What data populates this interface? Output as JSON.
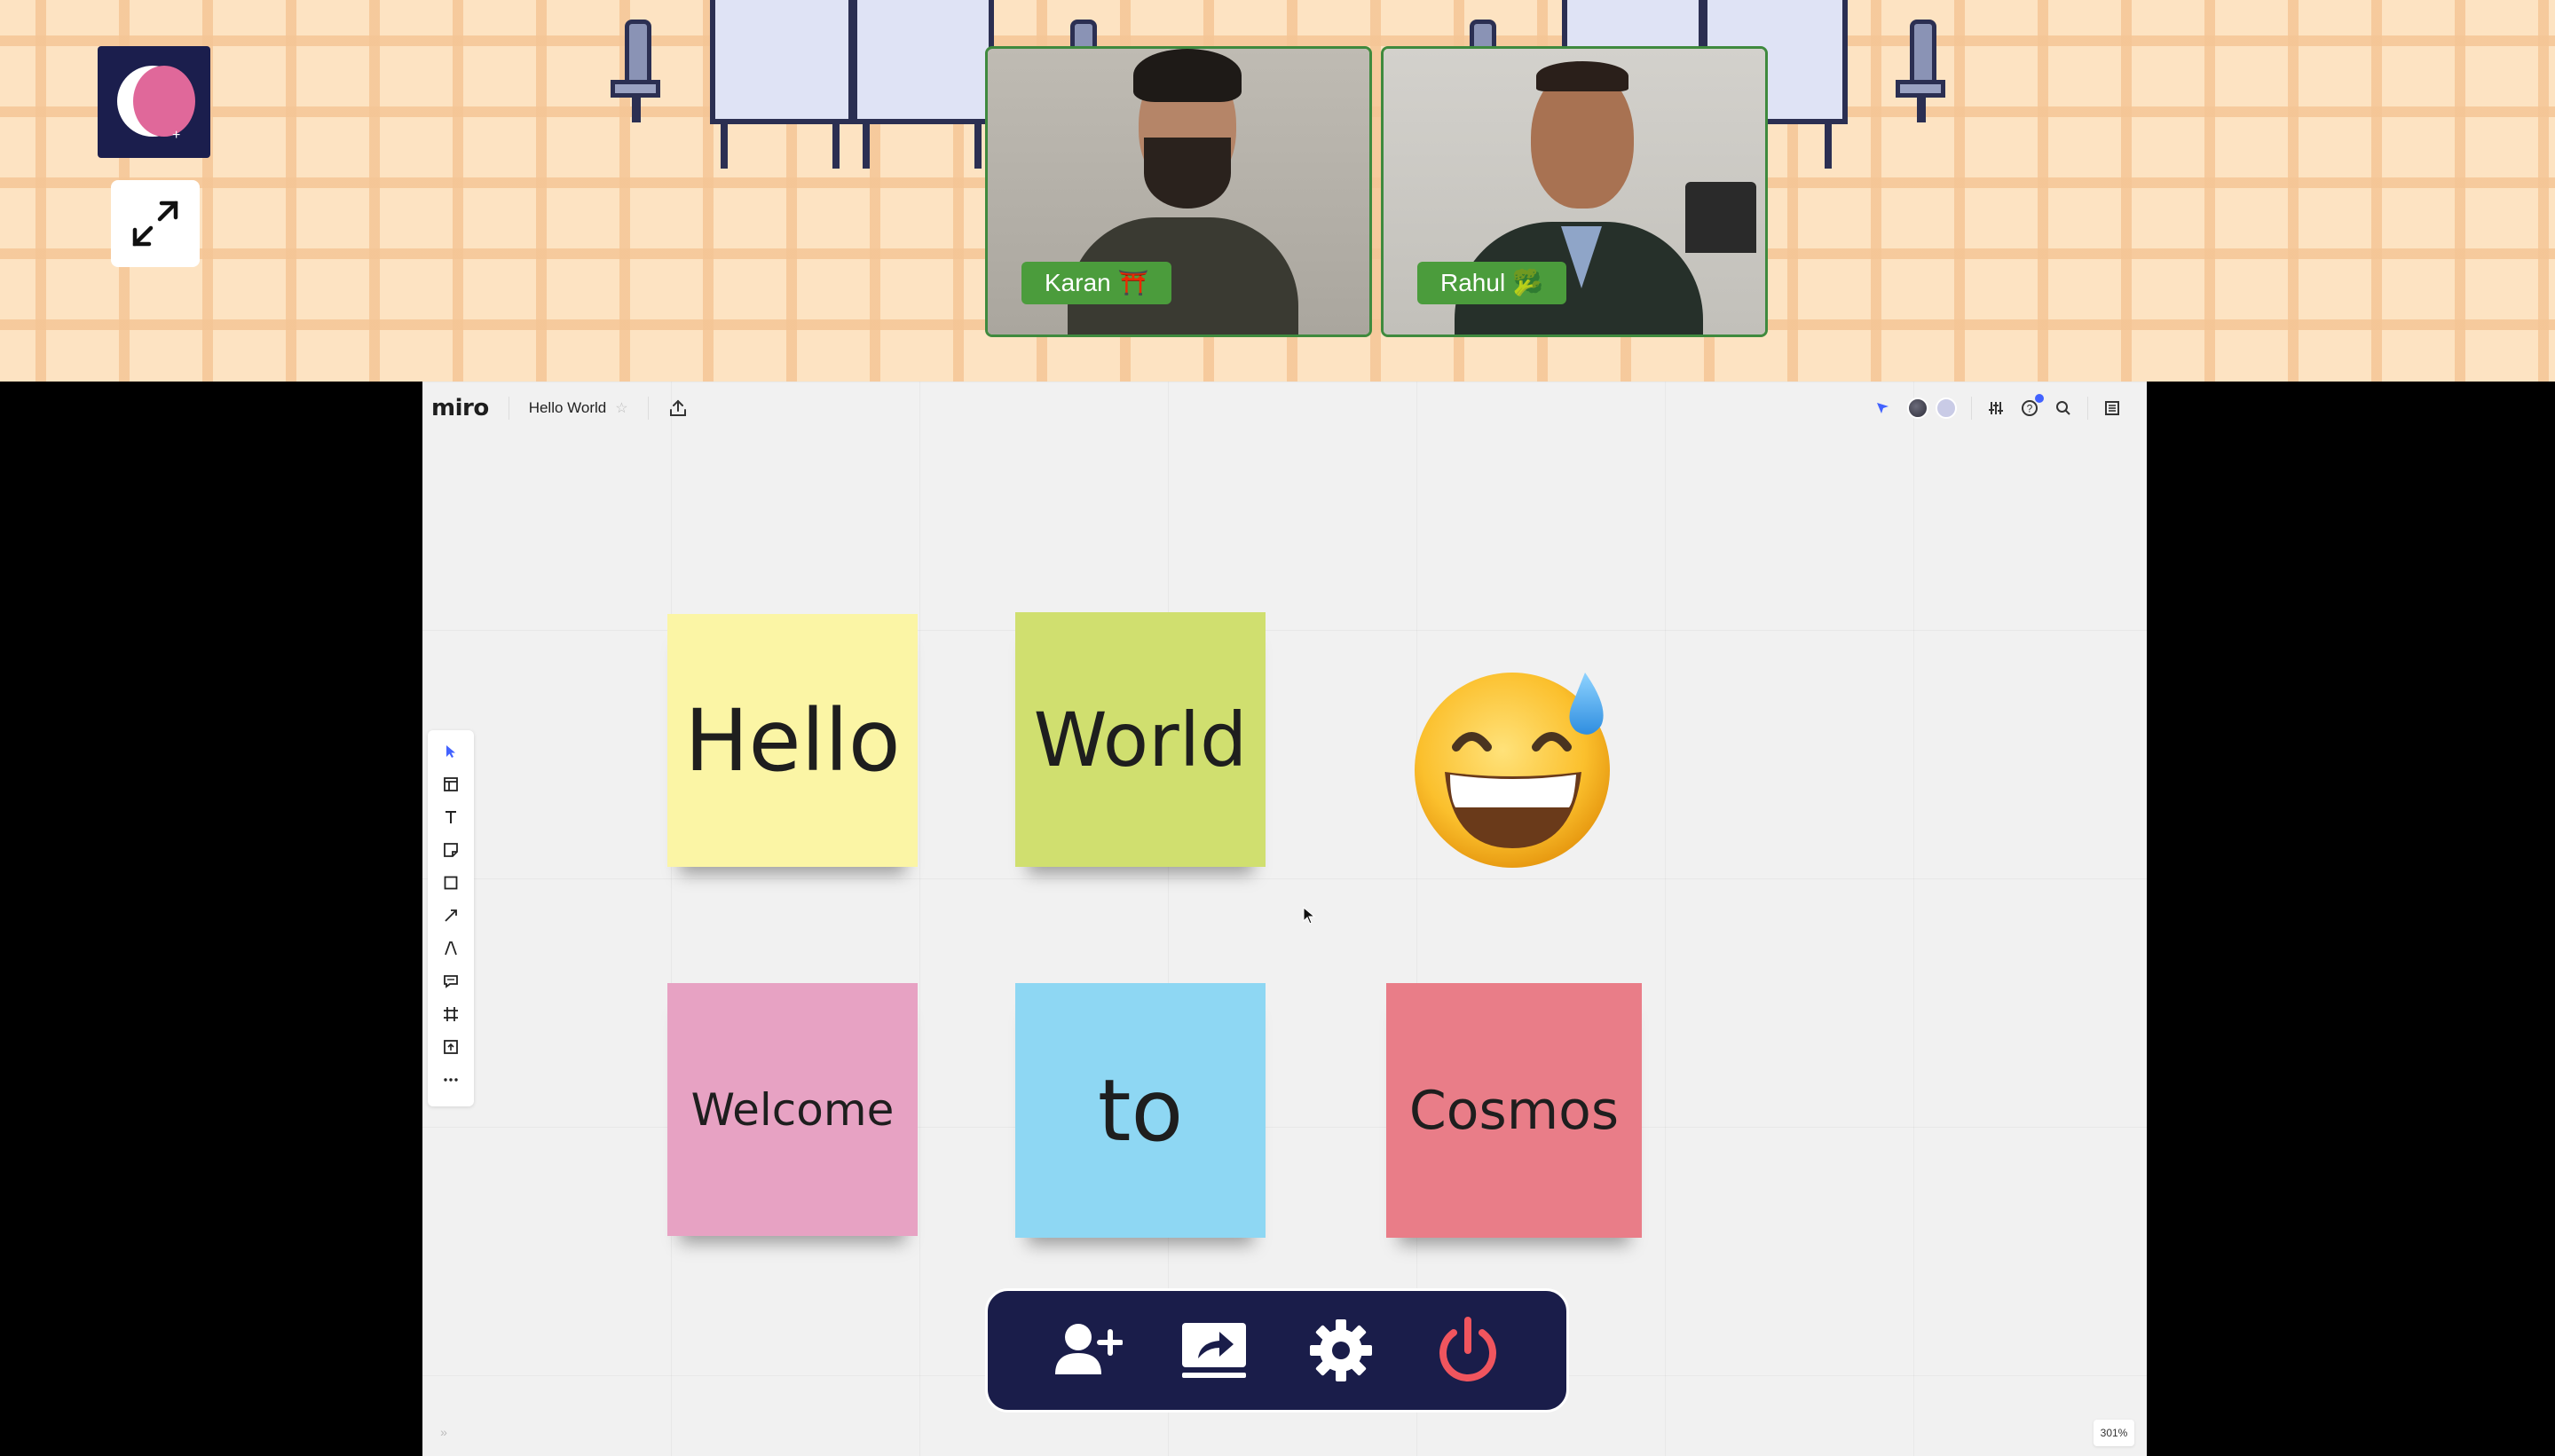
{
  "office": {
    "participants": [
      {
        "name": "Karan ⛩️",
        "video_bg": "#b7b4ad",
        "shirt": "#3a3a32",
        "skin": "#b98a6a"
      },
      {
        "name": "Rahul 🥦",
        "video_bg": "#c9c7c2",
        "shirt": "#26302a",
        "skin": "#a87252"
      }
    ]
  },
  "miro": {
    "logo": "miro",
    "board_name": "Hello World",
    "star": "☆",
    "toolbar": [
      {
        "name": "select-tool",
        "icon": "cursor-arrow-icon"
      },
      {
        "name": "templates-tool",
        "icon": "template-icon"
      },
      {
        "name": "text-tool",
        "icon": "text-icon"
      },
      {
        "name": "sticky-note-tool",
        "icon": "sticky-note-icon"
      },
      {
        "name": "shape-tool",
        "icon": "square-icon"
      },
      {
        "name": "connection-line-tool",
        "icon": "arrow-line-icon"
      },
      {
        "name": "pen-tool",
        "icon": "pen-icon"
      },
      {
        "name": "comment-tool",
        "icon": "comment-icon"
      },
      {
        "name": "frame-tool",
        "icon": "frame-icon"
      },
      {
        "name": "upload-tool",
        "icon": "upload-icon"
      },
      {
        "name": "more-tools",
        "icon": "more-icon"
      }
    ],
    "stickies": [
      {
        "text": "Hello",
        "color": "#fbf5a5"
      },
      {
        "text": "World",
        "color": "#d0df6f"
      },
      {
        "text": "Welcome",
        "color": "#e7a2c3"
      },
      {
        "text": "to",
        "color": "#8ed7f3"
      },
      {
        "text": "Cosmos",
        "color": "#e97d88"
      }
    ],
    "emoji": "grinning-face-with-sweat",
    "zoom": "301%",
    "collapse": "»"
  },
  "controls": [
    {
      "name": "invite-button",
      "icon": "add-user-icon"
    },
    {
      "name": "share-screen-button",
      "icon": "share-screen-icon"
    },
    {
      "name": "settings-button",
      "icon": "gear-icon"
    },
    {
      "name": "leave-button",
      "icon": "power-icon",
      "color": "#f0555e"
    }
  ]
}
